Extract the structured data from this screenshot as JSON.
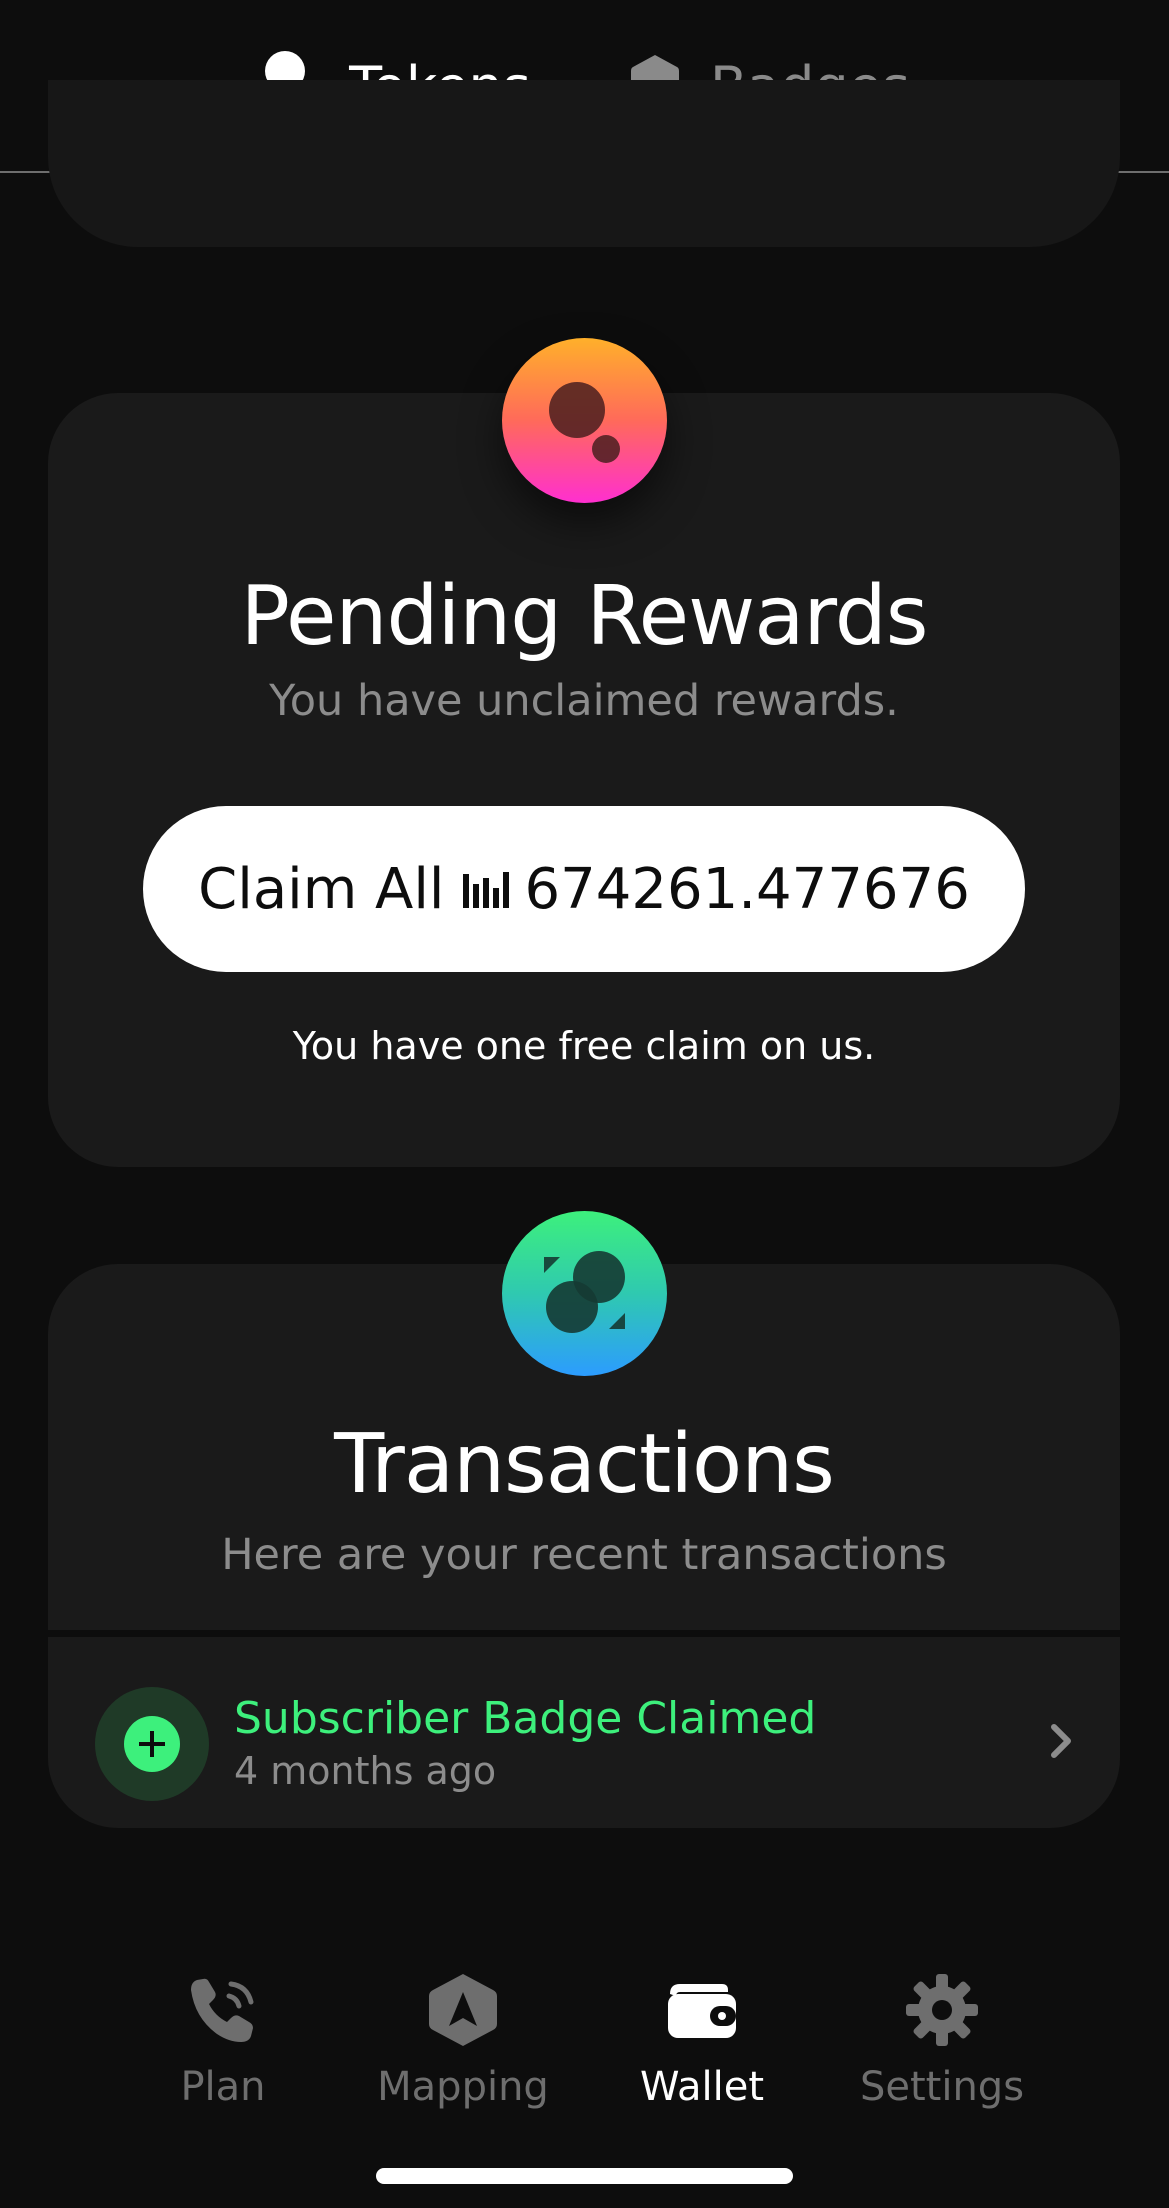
{
  "tabs": {
    "tokens_label": "Tokens",
    "badges_label": "Badges",
    "active": "Tokens"
  },
  "rewards": {
    "title": "Pending Rewards",
    "subtitle": "You have unclaimed rewards.",
    "claim_label": "Claim All",
    "claim_amount": "674261.477676",
    "free_claim_note": "You have one free claim on us."
  },
  "transactions": {
    "title": "Transactions",
    "subtitle": "Here are your recent transactions",
    "items": [
      {
        "title": "Subscriber Badge Claimed",
        "time": "4 months ago",
        "icon": "plus-icon"
      }
    ]
  },
  "nav": {
    "items": [
      {
        "label": "Plan",
        "icon": "phone-icon"
      },
      {
        "label": "Mapping",
        "icon": "navigation-icon"
      },
      {
        "label": "Wallet",
        "icon": "wallet-icon"
      },
      {
        "label": "Settings",
        "icon": "gear-icon"
      }
    ],
    "active": "Wallet"
  },
  "colors": {
    "background": "#0d0d0d",
    "card": "#1a1a1a",
    "accent_green": "#3df07c",
    "muted_text": "#8c8c8c"
  }
}
